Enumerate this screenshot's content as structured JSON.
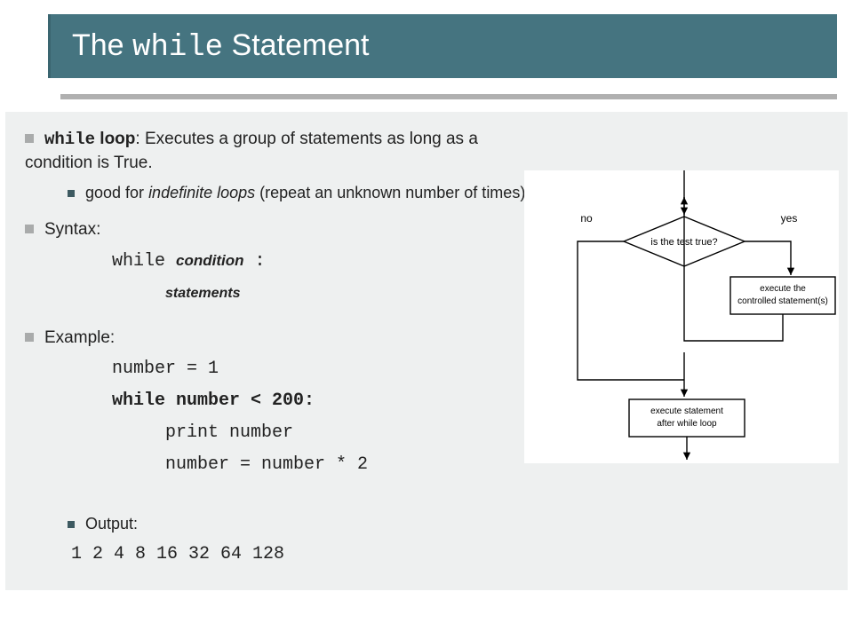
{
  "title": {
    "pre": "The ",
    "code": "while",
    "post": " Statement"
  },
  "b1": {
    "term": "while",
    "term2": " loop",
    "rest": ": Executes a group of statements as long as a condition is True.",
    "sub_pre": "good for ",
    "sub_ital": "indefinite loops",
    "sub_post": " (repeat an unknown number of times)"
  },
  "syntax": {
    "label": "Syntax:",
    "kw": "while ",
    "cond": "condition",
    "colon": " :",
    "stmts": "statements"
  },
  "example": {
    "label": "Example:",
    "l1": "number = 1",
    "l2": "while number < 200:",
    "l3": "print number",
    "l4": "number = number * 2"
  },
  "output": {
    "label": "Output:",
    "vals": "1 2 4 8 16 32 64 128"
  },
  "flow": {
    "diamond": "is the test true?",
    "no": "no",
    "yes": "yes",
    "exec1a": "execute the",
    "exec1b": "controlled statement(s)",
    "exec2a": "execute statement",
    "exec2b": "after while loop"
  }
}
